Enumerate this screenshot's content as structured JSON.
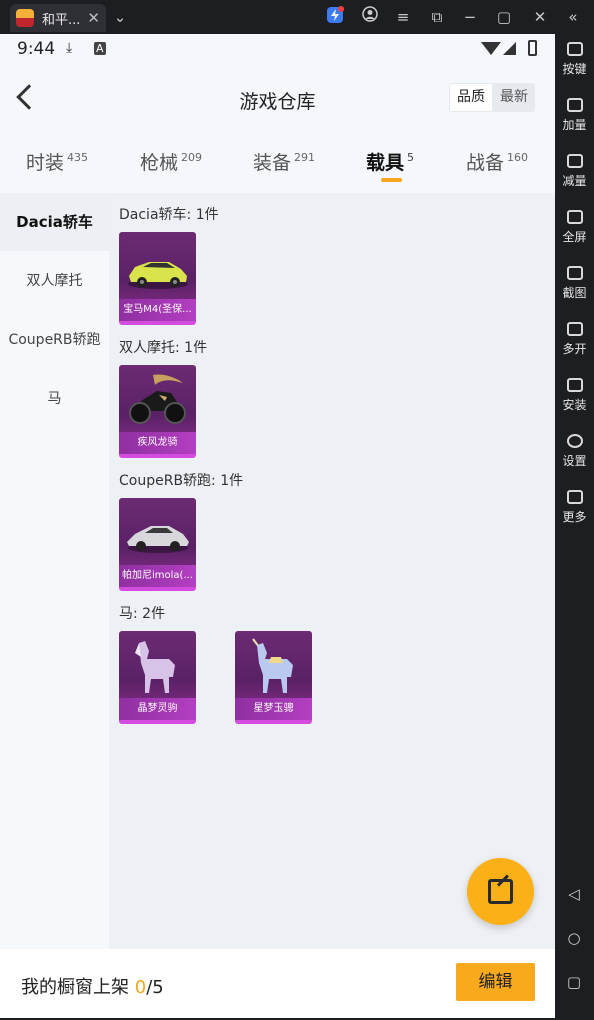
{
  "titlebar": {
    "tab_title": "和平...",
    "close_glyph": "✕",
    "icons": [
      "chevron-down-icon",
      "bolt-icon",
      "account-icon",
      "menu-icon",
      "popout-icon",
      "minimize-icon",
      "maximize-icon",
      "close-icon",
      "collapse-icon"
    ]
  },
  "emulator_sidebar": {
    "items": [
      {
        "label": "按键",
        "icon": "keyboard-icon"
      },
      {
        "label": "加量",
        "icon": "volume-up-icon"
      },
      {
        "label": "减量",
        "icon": "volume-down-icon"
      },
      {
        "label": "全屏",
        "icon": "fullscreen-icon"
      },
      {
        "label": "截图",
        "icon": "scissors-icon"
      },
      {
        "label": "多开",
        "icon": "multi-instance-icon"
      },
      {
        "label": "安装",
        "icon": "apk-install-icon"
      },
      {
        "label": "设置",
        "icon": "gear-icon"
      },
      {
        "label": "更多",
        "icon": "more-icon"
      }
    ],
    "nav": [
      "back-triangle-icon",
      "home-circle-icon",
      "recents-square-icon"
    ]
  },
  "status_bar": {
    "time": "9:44",
    "icons": [
      "download-icon",
      "a-badge-icon",
      "wifi-icon",
      "signal-icon",
      "battery-icon"
    ]
  },
  "header": {
    "title": "游戏仓库",
    "sort_options": [
      "品质",
      "最新"
    ],
    "active_sort": "品质"
  },
  "categories": [
    {
      "label": "时装",
      "count": "435"
    },
    {
      "label": "枪械",
      "count": "209"
    },
    {
      "label": "装备",
      "count": "291"
    },
    {
      "label": "载具",
      "count": "5",
      "active": true
    },
    {
      "label": "战备",
      "count": "160"
    }
  ],
  "left_nav": [
    {
      "label": "Dacia轿车",
      "active": true
    },
    {
      "label": "双人摩托"
    },
    {
      "label": "CoupeRB轿跑"
    },
    {
      "label": "马"
    }
  ],
  "sections": [
    {
      "title": "Dacia轿车: 1件",
      "items": [
        {
          "name": "宝马M4(圣保..."
        }
      ]
    },
    {
      "title": "双人摩托: 1件",
      "items": [
        {
          "name": "疾风龙骑"
        }
      ]
    },
    {
      "title": "CoupeRB轿跑: 1件",
      "items": [
        {
          "name": "帕加尼imola(..."
        }
      ]
    },
    {
      "title": "马: 2件",
      "items": [
        {
          "name": "晶梦灵驹"
        },
        {
          "name": "星梦玉骢"
        }
      ]
    }
  ],
  "fab": {
    "icon": "share-external-icon"
  },
  "bottom_bar": {
    "label_prefix": "我的橱窗上架 ",
    "current": "0",
    "total": "/5",
    "edit_label": "编辑"
  },
  "colors": {
    "accent": "#f9a91c",
    "card_bg": "#6c2b73",
    "card_name_bg": "#b33fc2"
  }
}
